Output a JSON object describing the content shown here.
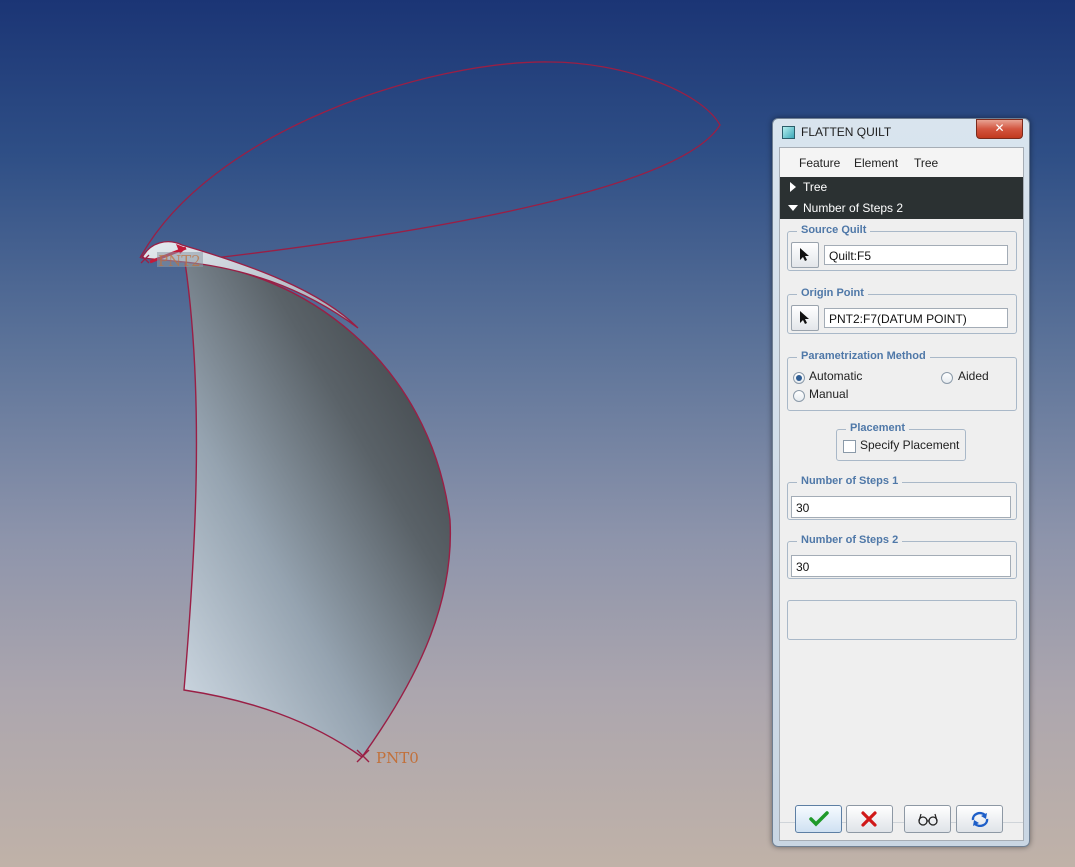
{
  "viewport": {
    "point_labels": [
      "PNT2",
      "PNT0"
    ]
  },
  "dialog": {
    "title": "FLATTEN QUILT",
    "close_symbol": "✕",
    "menu": [
      "Feature",
      "Element",
      "Tree"
    ],
    "tree_section": "Tree",
    "active_section": "Number of Steps 2",
    "source_quilt": {
      "label": "Source Quilt",
      "value": "Quilt:F5"
    },
    "origin_point": {
      "label": "Origin Point",
      "value": "PNT2:F7(DATUM POINT)"
    },
    "parametrization": {
      "label": "Parametrization Method",
      "options": [
        {
          "label": "Automatic",
          "selected": true
        },
        {
          "label": "Aided",
          "selected": false
        },
        {
          "label": "Manual",
          "selected": false
        }
      ]
    },
    "placement": {
      "label": "Placement",
      "checkbox_label": "Specify Placement",
      "checked": false
    },
    "steps1": {
      "label": "Number of Steps 1",
      "value": "30"
    },
    "steps2": {
      "label": "Number of Steps 2",
      "value": "30"
    },
    "footer_icons": [
      "checkmark-icon",
      "x-icon",
      "glasses-icon",
      "refresh-icon"
    ]
  }
}
